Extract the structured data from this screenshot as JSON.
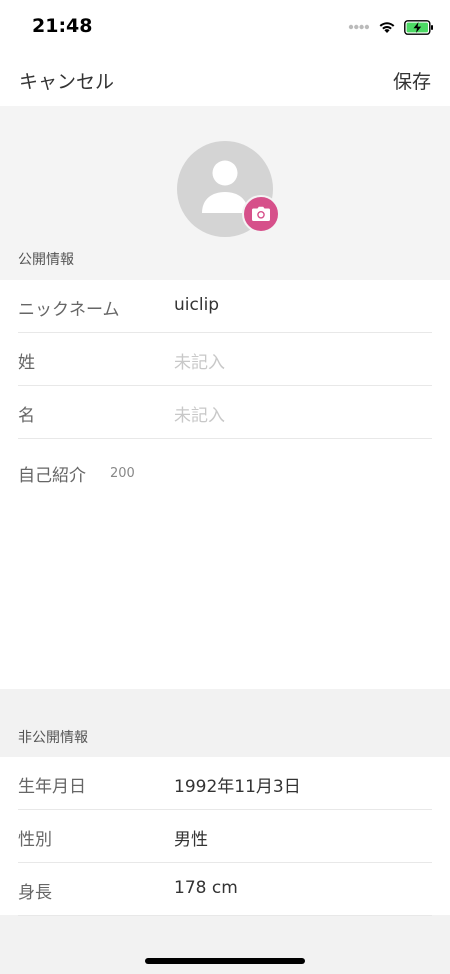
{
  "status": {
    "time": "21:48"
  },
  "nav": {
    "cancel_label": "キャンセル",
    "save_label": "保存"
  },
  "public_section": {
    "label": "公開情報",
    "rows": [
      {
        "label": "ニックネーム",
        "value": "uiclip"
      },
      {
        "label": "姓",
        "placeholder": "未記入"
      },
      {
        "label": "名",
        "placeholder": "未記入"
      }
    ],
    "bio": {
      "label": "自己紹介",
      "counter": "200"
    }
  },
  "private_section": {
    "label": "非公開情報",
    "rows": [
      {
        "label": "生年月日",
        "value": "1992年11月3日"
      },
      {
        "label": "性別",
        "value": "男性"
      },
      {
        "label": "身長",
        "value": "178 cm"
      }
    ]
  },
  "colors": {
    "accent": "#d6508a",
    "avatar_bg": "#d4d4d4",
    "section_bg": "#f4f4f4"
  },
  "icons": {
    "avatar": "person-icon",
    "camera": "camera-icon",
    "wifi": "wifi-icon",
    "battery": "battery-charging-icon",
    "signal": "signal-dots-icon"
  }
}
